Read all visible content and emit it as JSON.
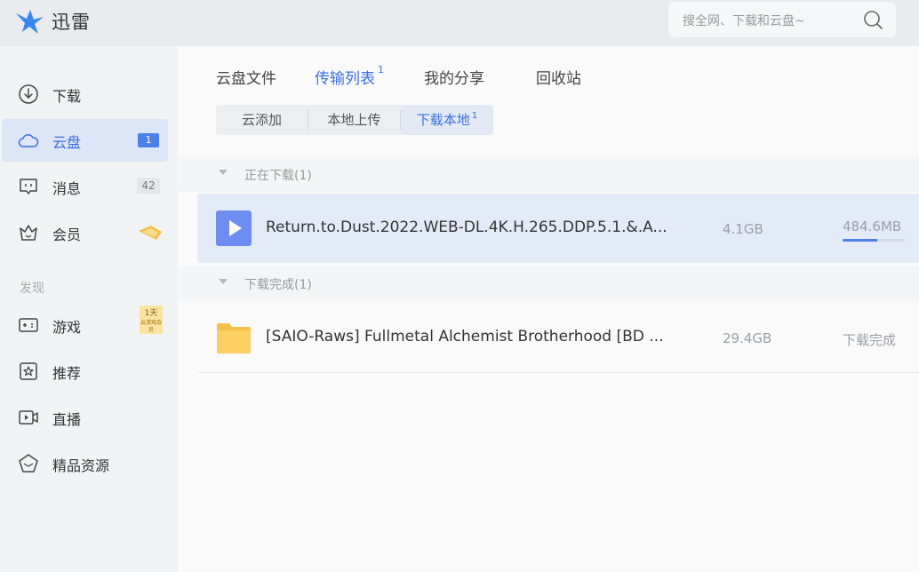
{
  "app": {
    "title": "迅雷"
  },
  "search": {
    "placeholder": "搜全网、下载和云盘~"
  },
  "sidebar": {
    "items": [
      {
        "label": "下载",
        "icon": "download-icon"
      },
      {
        "label": "云盘",
        "icon": "cloud-icon",
        "badge": "1",
        "active": true
      },
      {
        "label": "消息",
        "icon": "message-icon",
        "badge": "42"
      },
      {
        "label": "会员",
        "icon": "crown-icon"
      }
    ],
    "section": "发现",
    "discover": [
      {
        "label": "游戏",
        "icon": "gamepad-icon",
        "tag_top": "1天",
        "tag_bottom": "云游戏会员"
      },
      {
        "label": "推荐",
        "icon": "star-icon"
      },
      {
        "label": "直播",
        "icon": "live-icon"
      },
      {
        "label": "精品资源",
        "icon": "gem-icon"
      }
    ]
  },
  "tabs": [
    {
      "label": "云盘文件"
    },
    {
      "label": "传输列表",
      "badge": "1",
      "active": true
    },
    {
      "label": "我的分享"
    },
    {
      "label": "回收站"
    }
  ],
  "subtabs": [
    {
      "label": "云添加"
    },
    {
      "label": "本地上传"
    },
    {
      "label": "下载本地",
      "badge": "1",
      "active": true
    }
  ],
  "groups": {
    "downloading": {
      "title": "正在下载(1)",
      "items": [
        {
          "name": "Return.to.Dust.2022.WEB-DL.4K.H.265.DDP.5.1.&.A...",
          "size": "4.1GB",
          "status": "484.6MB",
          "progress": 0.56,
          "icon": "video-play-icon"
        }
      ]
    },
    "completed": {
      "title": "下载完成(1)",
      "items": [
        {
          "name": "[SAIO-Raws] Fullmetal Alchemist Brotherhood [BD ...",
          "size": "29.4GB",
          "status": "下载完成",
          "icon": "folder-icon"
        }
      ]
    }
  },
  "colors": {
    "accent": "#3a6fe0",
    "selected_row": "#e4ebf8",
    "folder": "#f7c04a",
    "video": "#6f8cf0"
  }
}
